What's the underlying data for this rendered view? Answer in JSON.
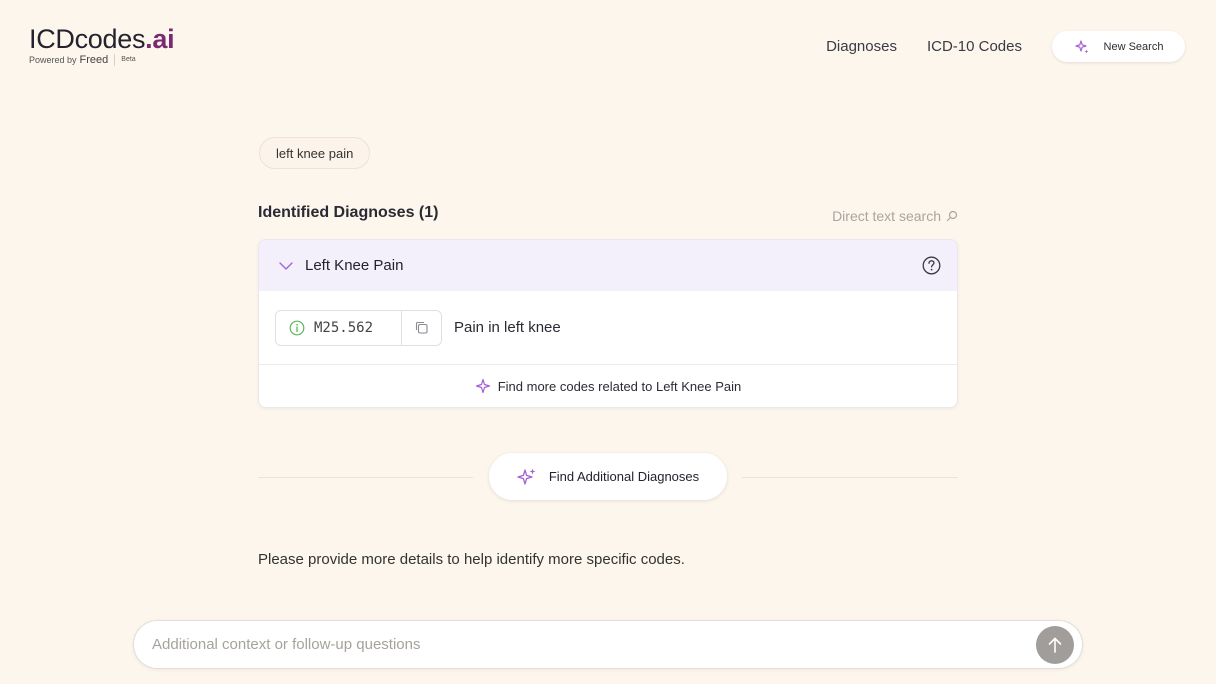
{
  "header": {
    "logo_main": "ICDcodes",
    "logo_ai": ".ai",
    "powered_by": "Powered by",
    "brand": "Freed",
    "beta": "Beta",
    "nav": [
      {
        "label": "Diagnoses"
      },
      {
        "label": "ICD-10 Codes"
      }
    ],
    "new_search_label": "New Search"
  },
  "query_chip": "left knee pain",
  "section": {
    "title": "Identified Diagnoses (1)",
    "direct_search_label": "Direct text search"
  },
  "diagnosis": {
    "title": "Left Knee Pain",
    "codes": [
      {
        "code": "M25.562",
        "description": "Pain in left knee"
      }
    ],
    "find_more_label": "Find more codes related to Left Knee Pain"
  },
  "find_additional_label": "Find Additional Diagnoses",
  "prompt_text": "Please provide more details to help identify more specific codes.",
  "input": {
    "placeholder": "Additional context or follow-up questions",
    "value": ""
  },
  "colors": {
    "background": "#fdf6ec",
    "accent_purple": "#a35fd6",
    "brand_ai": "#7a2a72",
    "card_header": "#f3f0fb",
    "info_green": "#5cb85c",
    "send_button": "#a09d9a"
  },
  "icons": {
    "new_search": "sparkle-icon",
    "direct_search": "search-icon",
    "chevron": "chevron-down-icon",
    "help": "help-icon",
    "info": "info-icon",
    "copy": "copy-icon",
    "find_more": "sparkle-icon",
    "send": "arrow-up-icon"
  }
}
